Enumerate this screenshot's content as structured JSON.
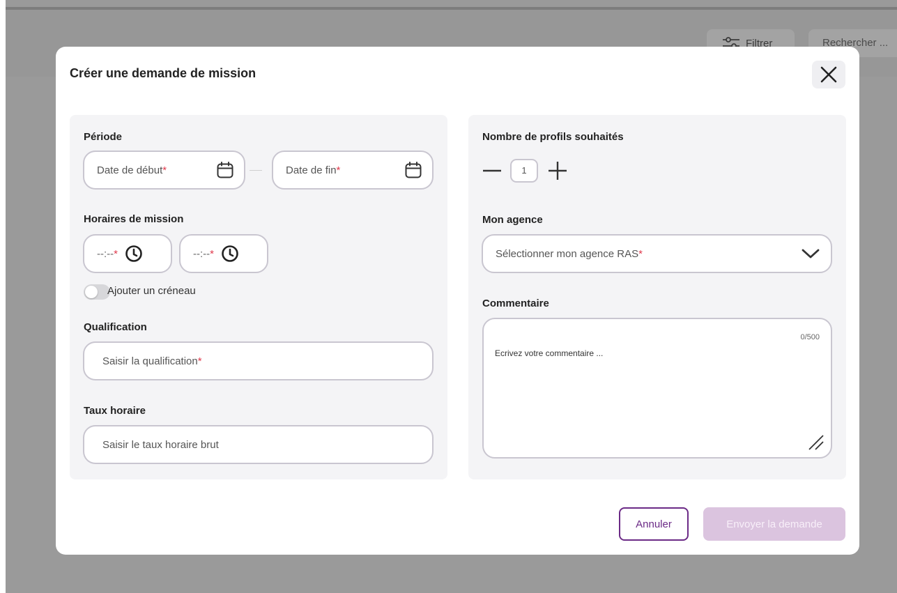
{
  "background": {
    "filter_label": "Filtrer",
    "search_placeholder": "Rechercher ..."
  },
  "modal": {
    "title": "Créer une demande de mission",
    "close_icon": "close-icon"
  },
  "periode": {
    "label": "Période",
    "start_placeholder": "Date de début",
    "end_placeholder": "Date de fin",
    "required_mark": "*",
    "icon": "calendar-icon"
  },
  "horaires": {
    "label": "Horaires de mission",
    "start_placeholder": "--:--",
    "end_placeholder": "--:--",
    "required_mark": "*",
    "icon": "clock-icon",
    "toggle_label": "Ajouter un créneau",
    "toggle_on": false
  },
  "qualification": {
    "label": "Qualification",
    "placeholder": "Saisir la qualification",
    "required_mark": "*"
  },
  "taux": {
    "label": "Taux horaire",
    "placeholder": "Saisir le taux horaire brut"
  },
  "profils": {
    "label": "Nombre de profils souhaités",
    "value": "1"
  },
  "agence": {
    "label": "Mon agence",
    "placeholder": "Sélectionner mon agence RAS",
    "required_mark": "*",
    "icon": "chevron-down-icon"
  },
  "commentaire": {
    "label": "Commentaire",
    "counter": "0/500",
    "placeholder": "Ecrivez votre commentaire ..."
  },
  "actions": {
    "cancel_label": "Annuler",
    "submit_label": "Envoyer la demande"
  },
  "colors": {
    "accent": "#6b2a86",
    "accent_disabled": "#dbc4df",
    "required": "#e03a4d",
    "field_border": "#c9c6d0",
    "panel_bg": "#f4f4f6",
    "backdrop": "#9a9a9a"
  }
}
